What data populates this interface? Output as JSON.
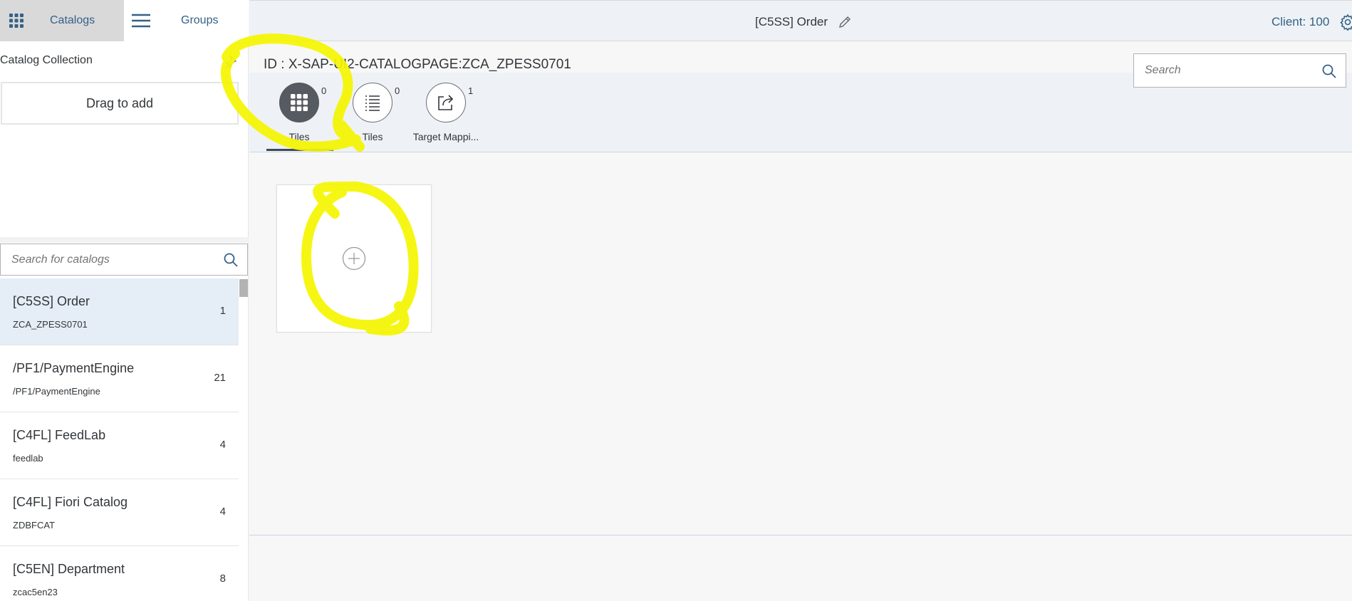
{
  "shell": {
    "catalogs_label": "Catalogs",
    "groups_label": "Groups",
    "title": "[C5SS] Order",
    "client": "Client: 100"
  },
  "left": {
    "collection_title": "Catalog Collection",
    "drag_label": "Drag to add",
    "search_placeholder": "Search for catalogs",
    "catalogs": [
      {
        "title": "[C5SS] Order",
        "sub": "ZCA_ZPESS0701",
        "count": "1"
      },
      {
        "title": "/PF1/PaymentEngine",
        "sub": "/PF1/PaymentEngine",
        "count": "21"
      },
      {
        "title": "[C4FL] FeedLab",
        "sub": "feedlab",
        "count": "4"
      },
      {
        "title": "[C4FL] Fiori Catalog",
        "sub": "ZDBFCAT",
        "count": "4"
      },
      {
        "title": "[C5EN] Department",
        "sub": "zcac5en23",
        "count": "8"
      }
    ]
  },
  "main": {
    "object_id": "ID : X-SAP-UI2-CATALOGPAGE:ZCA_ZPESS0701",
    "search_placeholder": "Search",
    "tabs": [
      {
        "label": "Tiles",
        "count": "0",
        "icon": "grid-icon"
      },
      {
        "label": "Tiles",
        "count": "0",
        "icon": "list-icon"
      },
      {
        "label": "Target Mappi...",
        "count": "1",
        "icon": "share-icon"
      }
    ]
  },
  "colors": {
    "accent": "#346187",
    "selected_row": "#e5eef6",
    "annotation": "#f5f500"
  }
}
